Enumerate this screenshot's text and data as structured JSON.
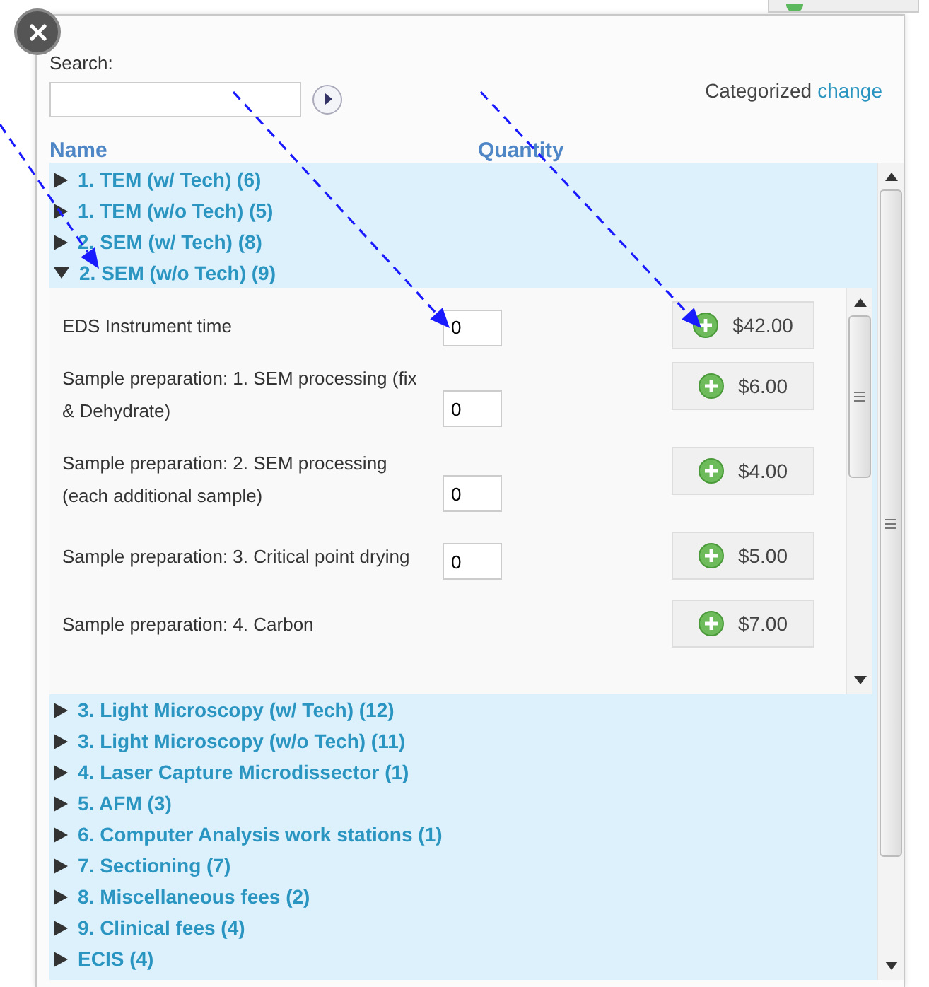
{
  "search": {
    "label": "Search:"
  },
  "view": {
    "label": "Categorized",
    "link": "change"
  },
  "columns": [
    "Name",
    "Quantity"
  ],
  "categories": [
    {
      "label": "1. TEM (w/ Tech) (6)",
      "expanded": false
    },
    {
      "label": "1. TEM (w/o Tech) (5)",
      "expanded": false
    },
    {
      "label": "2. SEM (w/ Tech) (8)",
      "expanded": false
    },
    {
      "label": "2. SEM (w/o Tech) (9)",
      "expanded": true,
      "items": [
        {
          "description": "EDS Instrument time",
          "quantity": "0",
          "price": "$42.00"
        },
        {
          "description": "Sample preparation: 1. SEM processing (fix & Dehydrate)",
          "quantity": "0",
          "price": "$6.00"
        },
        {
          "description": "Sample preparation: 2. SEM processing (each additional sample)",
          "quantity": "0",
          "price": "$4.00"
        },
        {
          "description": "Sample preparation: 3. Critical point drying",
          "quantity": "0",
          "price": "$5.00"
        },
        {
          "description": "Sample preparation: 4. Carbon",
          "price": "$7.00"
        }
      ]
    },
    {
      "label": "3. Light Microscopy (w/ Tech) (12)",
      "expanded": false
    },
    {
      "label": "3. Light Microscopy (w/o Tech) (11)",
      "expanded": false
    },
    {
      "label": "4. Laser Capture Microdissector (1)",
      "expanded": false
    },
    {
      "label": "5. AFM (3)",
      "expanded": false
    },
    {
      "label": "6. Computer Analysis work stations (1)",
      "expanded": false
    },
    {
      "label": "7. Sectioning (7)",
      "expanded": false
    },
    {
      "label": "8. Miscellaneous fees (2)",
      "expanded": false
    },
    {
      "label": "9. Clinical fees (4)",
      "expanded": false
    },
    {
      "label": "ECIS (4)",
      "expanded": false
    }
  ]
}
